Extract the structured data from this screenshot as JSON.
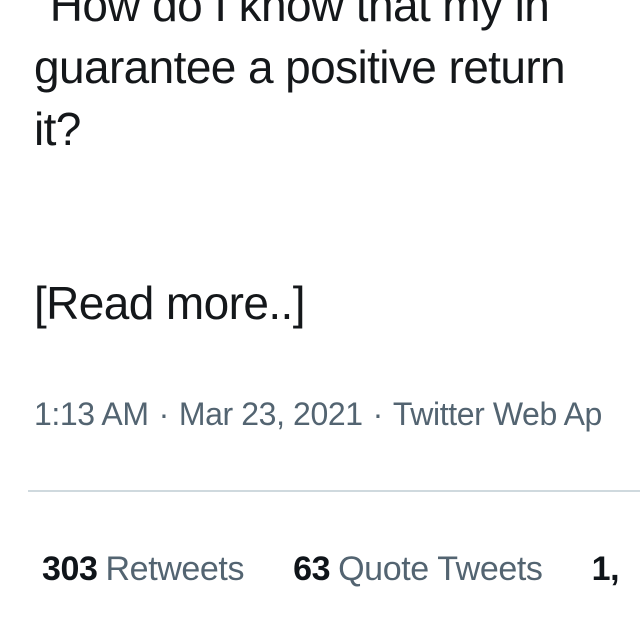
{
  "tweet": {
    "text_lines": [
      "\"How do I know that my in",
      "guarantee a positive return",
      "it?"
    ],
    "read_more": "[Read more..]"
  },
  "meta": {
    "time": "1:13 AM",
    "separator": "·",
    "date": "Mar 23, 2021",
    "source": "Twitter Web Ap"
  },
  "stats": [
    {
      "count": "303",
      "label": "Retweets"
    },
    {
      "count": "63",
      "label": "Quote Tweets"
    },
    {
      "count": "1,",
      "label": ""
    }
  ]
}
